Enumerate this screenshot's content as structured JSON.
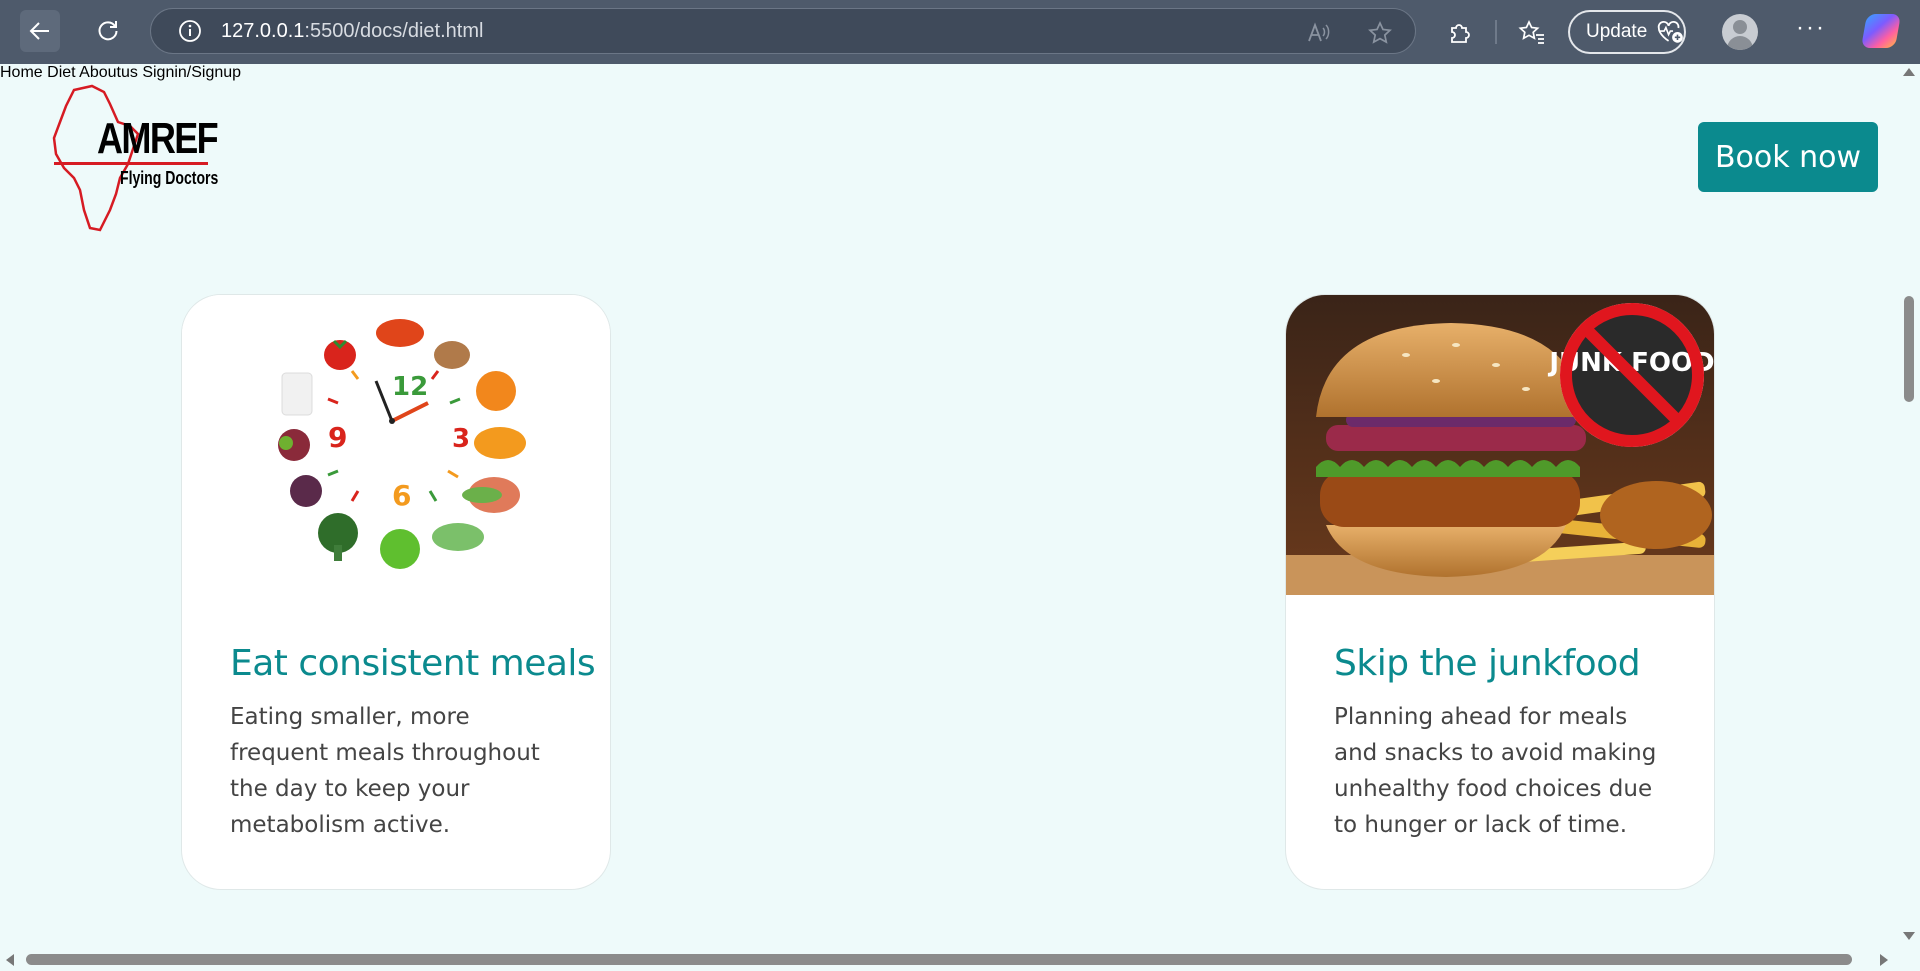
{
  "browser": {
    "url_host": "127.0.0.1",
    "url_path": ":5500/docs/diet.html",
    "update_label": "Update",
    "more_label": "···"
  },
  "site": {
    "logo_name": "AMREF",
    "logo_tagline": "Flying Doctors",
    "nav": [
      {
        "label": "Home"
      },
      {
        "label": "Diet"
      },
      {
        "label": "Aboutus"
      },
      {
        "label": "Signin/Signup"
      }
    ],
    "cta_label": "Book now",
    "accent_color": "#0b8a8e",
    "background_color": "#eefafa"
  },
  "cards": [
    {
      "title": "Eat consistent meals",
      "text": "Eating smaller, more frequent meals throughout the day to keep your metabolism active.",
      "image": "healthy-food-clock",
      "clock_numbers": [
        "12",
        "3",
        "6",
        "9"
      ]
    },
    {
      "title": "Skip the junkfood",
      "text": "Planning ahead for meals and snacks to avoid making unhealthy food choices due to hunger or lack of time.",
      "image": "burger-no-junk-food",
      "badge_text": "JUNK FOOD"
    }
  ]
}
